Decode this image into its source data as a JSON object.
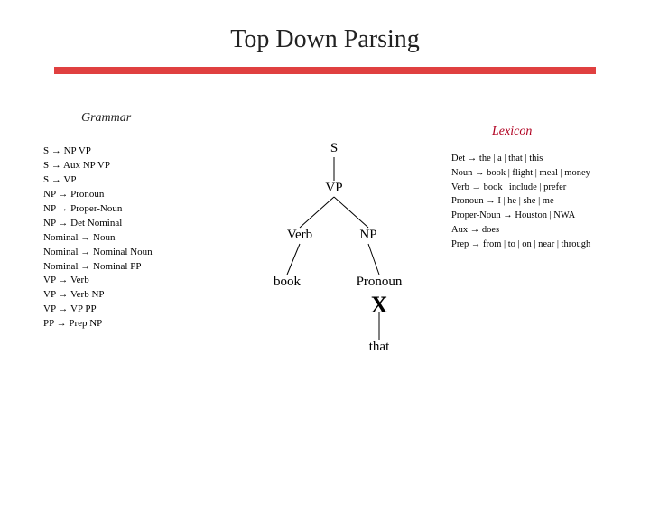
{
  "title": "Top Down Parsing",
  "labels": {
    "grammar": "Grammar",
    "lexicon": "Lexicon"
  },
  "arrow": "→",
  "sep": " | ",
  "grammar": [
    {
      "lhs": "S",
      "rhs": "NP VP"
    },
    {
      "lhs": "S",
      "rhs": "Aux NP VP"
    },
    {
      "lhs": "S",
      "rhs": "VP"
    },
    {
      "lhs": "NP",
      "rhs": "Pronoun"
    },
    {
      "lhs": "NP",
      "rhs": "Proper-Noun"
    },
    {
      "lhs": "NP",
      "rhs": "Det Nominal"
    },
    {
      "lhs": "Nominal",
      "rhs": "Noun"
    },
    {
      "lhs": "Nominal",
      "rhs": "Nominal Noun"
    },
    {
      "lhs": "Nominal",
      "rhs": "Nominal PP"
    },
    {
      "lhs": "VP",
      "rhs": "Verb"
    },
    {
      "lhs": "VP",
      "rhs": "Verb NP"
    },
    {
      "lhs": "VP",
      "rhs": "VP PP"
    },
    {
      "lhs": "PP",
      "rhs": "Prep NP"
    }
  ],
  "lexicon": [
    {
      "lhs": "Det",
      "rhs": "the | a | that | this"
    },
    {
      "lhs": "Noun",
      "rhs": "book | flight | meal | money"
    },
    {
      "lhs": "Verb",
      "rhs": "book | include | prefer"
    },
    {
      "lhs": "Pronoun",
      "rhs": "I | he | she | me"
    },
    {
      "lhs": "Proper-Noun",
      "rhs": "Houston | NWA"
    },
    {
      "lhs": "Aux",
      "rhs": "does"
    },
    {
      "lhs": "Prep",
      "rhs": "from | to | on | near | through"
    }
  ],
  "tree": {
    "n1": "S",
    "n2": "VP",
    "n3": "Verb",
    "n4": "NP",
    "n5": "book",
    "n6": "Pronoun",
    "n7": "that",
    "strike": "X"
  }
}
